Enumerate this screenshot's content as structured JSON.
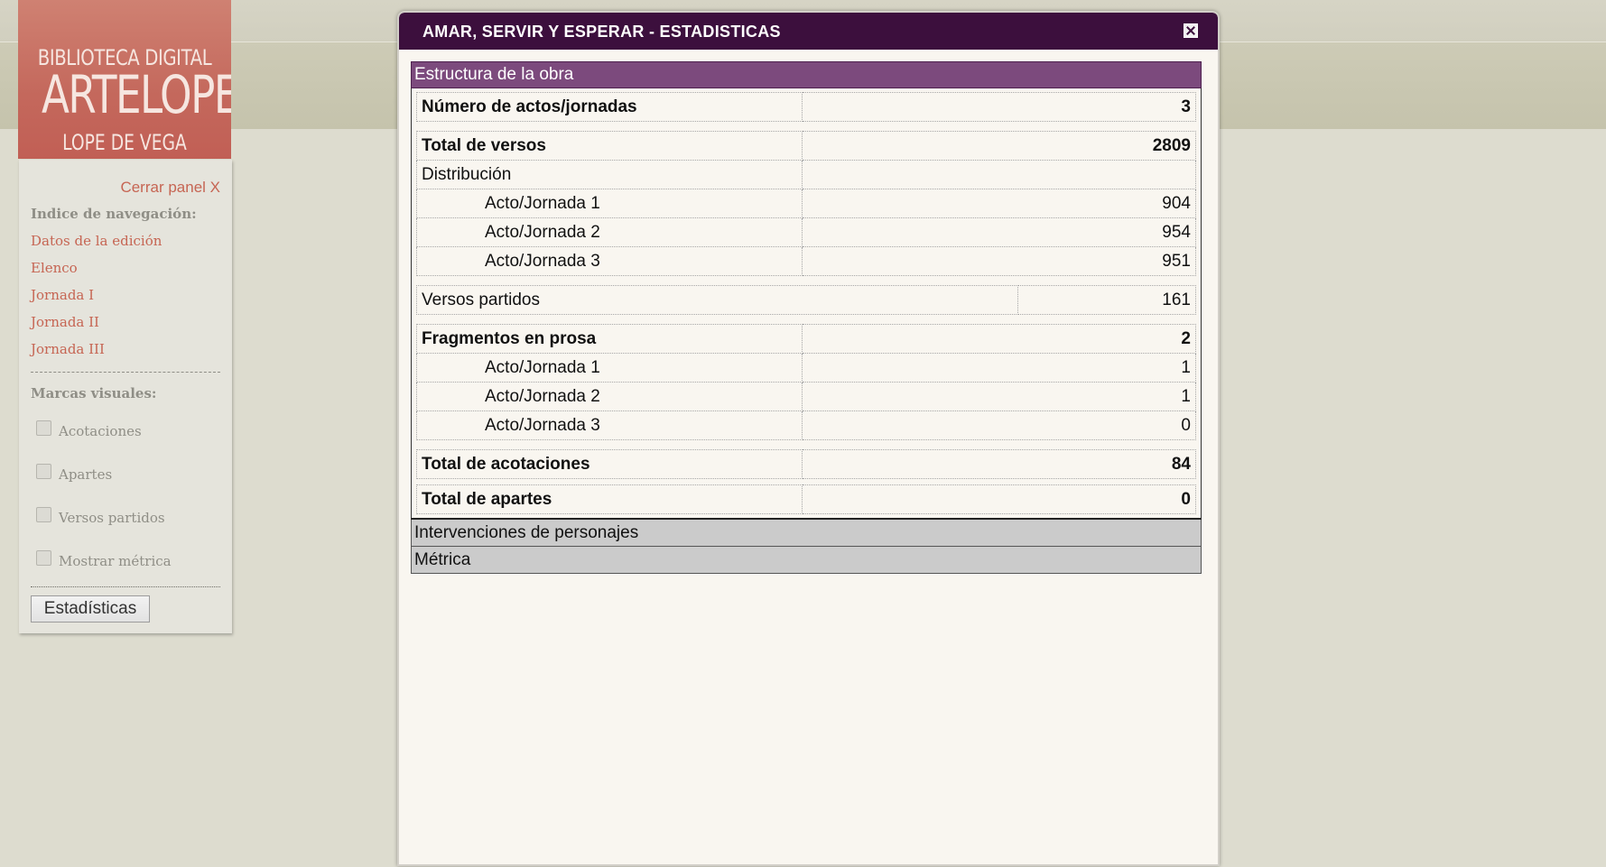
{
  "logo": {
    "line1": "BIBLIOTECA DIGITAL",
    "line2": "ARTELOPE",
    "line3": "LOPE DE VEGA"
  },
  "sidebar": {
    "close_label": "Cerrar panel X",
    "nav_heading": "Indice de navegación:",
    "nav_items": [
      "Datos de la edición",
      "Elenco",
      "Jornada I",
      "Jornada II",
      "Jornada III"
    ],
    "marks_heading": "Marcas visuales:",
    "checkboxes": [
      "Acotaciones",
      "Apartes",
      "Versos partidos",
      "Mostrar métrica"
    ],
    "stats_button": "Estadísticas"
  },
  "modal": {
    "title": "AMAR, SERVIR Y ESPERAR - ESTADISTICAS",
    "sections": {
      "structure": "Estructura de la obra",
      "interventions": "Intervenciones de personajes",
      "metric": "Métrica"
    },
    "stats": {
      "acts": {
        "label": "Número de actos/jornadas",
        "value": "3"
      },
      "verses": {
        "label": "Total de versos",
        "value": "2809"
      },
      "distribution_label": "Distribución",
      "verse_dist": [
        {
          "label": "Acto/Jornada 1",
          "value": "904"
        },
        {
          "label": "Acto/Jornada 2",
          "value": "954"
        },
        {
          "label": "Acto/Jornada 3",
          "value": "951"
        }
      ],
      "split_verses": {
        "label": "Versos partidos",
        "value": "161"
      },
      "prose": {
        "label": "Fragmentos en prosa",
        "value": "2"
      },
      "prose_dist": [
        {
          "label": "Acto/Jornada 1",
          "value": "1"
        },
        {
          "label": "Acto/Jornada 2",
          "value": "1"
        },
        {
          "label": "Acto/Jornada 3",
          "value": "0"
        }
      ],
      "stage_directions": {
        "label": "Total de acotaciones",
        "value": "84"
      },
      "asides": {
        "label": "Total de apartes",
        "value": "0"
      }
    }
  }
}
